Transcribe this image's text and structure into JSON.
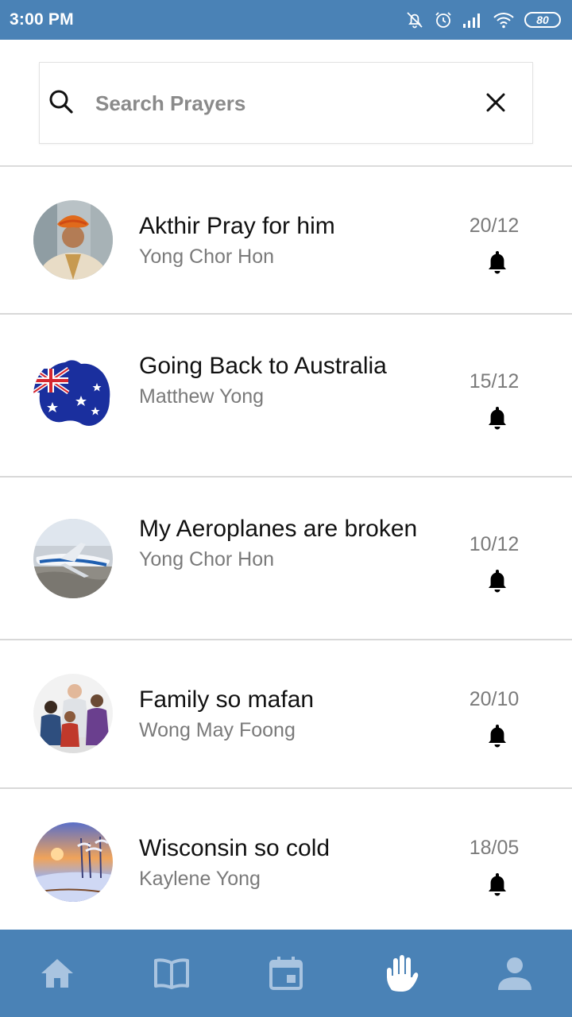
{
  "status_bar": {
    "time": "3:00 PM",
    "battery": "80",
    "icons": [
      "bell-off-icon",
      "alarm-icon",
      "signal-icon",
      "wifi-icon",
      "battery-icon"
    ]
  },
  "search": {
    "placeholder": "Search Prayers",
    "value": ""
  },
  "prayers": [
    {
      "title": "Akthir Pray for him",
      "author": "Yong Chor Hon",
      "date": "20/12"
    },
    {
      "title": "Going Back to Australia",
      "author": "Matthew Yong",
      "date": "15/12"
    },
    {
      "title": "My Aeroplanes are broken",
      "author": "Yong Chor Hon",
      "date": "10/12"
    },
    {
      "title": "Family so mafan",
      "author": "Wong May Foong",
      "date": "20/10"
    },
    {
      "title": "Wisconsin so cold",
      "author": "Kaylene Yong",
      "date": "18/05"
    }
  ],
  "bottom_nav": {
    "items": [
      "home-icon",
      "book-icon",
      "calendar-icon",
      "hand-icon",
      "person-icon"
    ],
    "active": "hand-icon"
  },
  "colors": {
    "primary": "#4a82b6",
    "nav_inactive": "#a9c4e0",
    "nav_active": "#ffffff"
  }
}
